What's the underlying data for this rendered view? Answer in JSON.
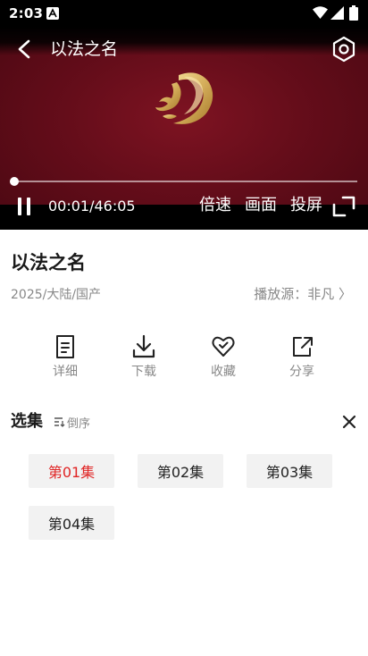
{
  "status_bar": {
    "time": "2:03"
  },
  "player": {
    "title": "以法之名",
    "current_time": "00:01",
    "total_time": "46:05",
    "time_display": "00:01/46:05",
    "progress": 0.0004,
    "controls": {
      "speed": "倍速",
      "picture": "画面",
      "cast": "投屏"
    },
    "colors": {
      "background": "#650d1a",
      "logo": "#d4ad5a"
    }
  },
  "info": {
    "title": "以法之名",
    "meta": "2025/大陆/国产",
    "source": "播放源：非凡 〉"
  },
  "actions": [
    {
      "label": "详细",
      "icon": "document-icon"
    },
    {
      "label": "下载",
      "icon": "download-icon"
    },
    {
      "label": "收藏",
      "icon": "heart-icon"
    },
    {
      "label": "分享",
      "icon": "share-icon"
    }
  ],
  "episodes": {
    "title": "选集",
    "sort_label": "倒序",
    "items": [
      {
        "label": "第01集",
        "active": true
      },
      {
        "label": "第02集",
        "active": false
      },
      {
        "label": "第03集",
        "active": false
      },
      {
        "label": "第04集",
        "active": false
      }
    ],
    "active_color": "#e02525"
  }
}
